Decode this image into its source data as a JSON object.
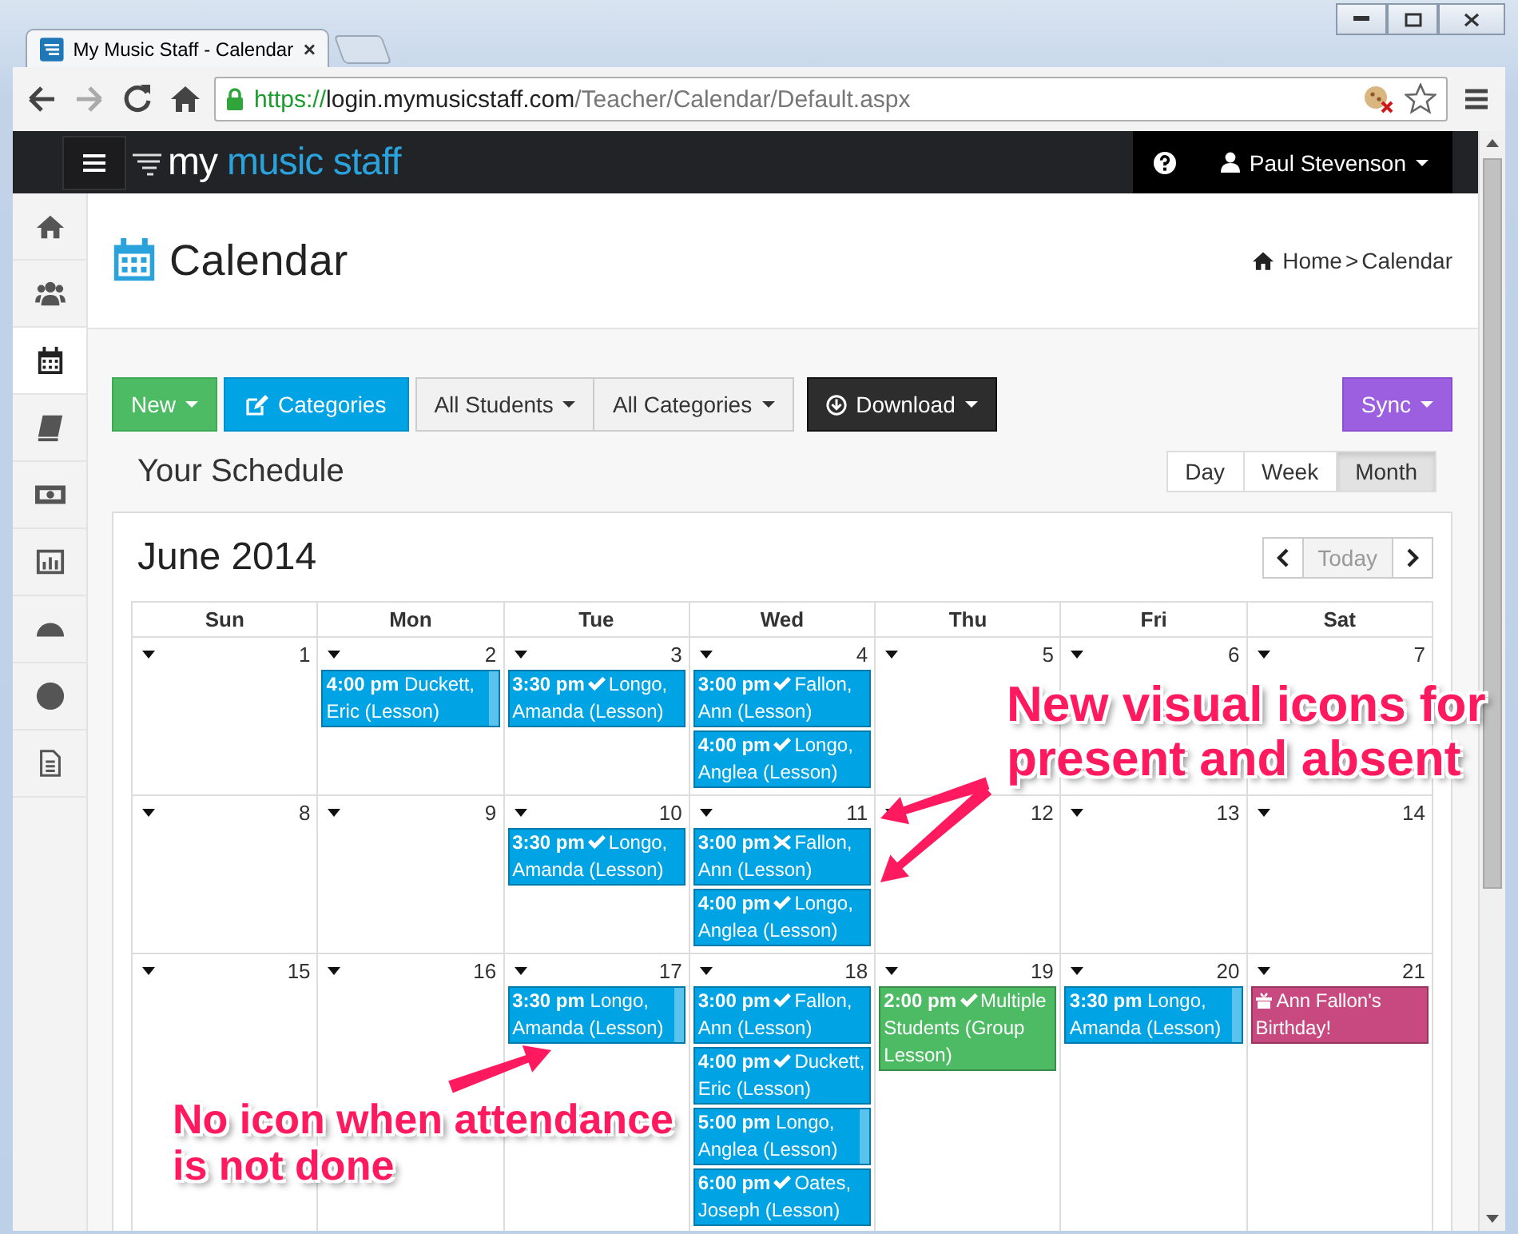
{
  "browser": {
    "tab_title": "My Music Staff - Calendar",
    "url": {
      "scheme": "https://",
      "host": "login.mymusicstaff.com",
      "path": "/Teacher/Calendar/Default.aspx"
    }
  },
  "navbar": {
    "logo": {
      "first": "my",
      "rest": "music staff"
    },
    "user": "Paul Stevenson"
  },
  "sidebar": {
    "items": [
      {
        "selected": false
      },
      {
        "selected": false
      },
      {
        "selected": true
      },
      {
        "selected": false
      },
      {
        "selected": false
      },
      {
        "selected": false
      },
      {
        "selected": false
      },
      {
        "selected": false
      },
      {
        "selected": false
      }
    ]
  },
  "page": {
    "title": "Calendar",
    "breadcrumb": {
      "home": "Home",
      "separator": ">",
      "current": "Calendar"
    }
  },
  "toolbar": {
    "buttons": [
      {
        "label": "New",
        "kind": "new",
        "caret": true
      },
      {
        "label": "Categories",
        "kind": "categories",
        "caret": false
      },
      {
        "label": "All Students",
        "kind": "filter",
        "caret": true
      },
      {
        "label": "All Categories",
        "kind": "filter",
        "caret": true
      },
      {
        "label": "Download",
        "kind": "download",
        "caret": true
      }
    ],
    "sync": {
      "label": "Sync",
      "caret": true
    }
  },
  "schedule": {
    "title": "Your Schedule",
    "views": [
      {
        "label": "Day",
        "selected": false
      },
      {
        "label": "Week",
        "selected": false
      },
      {
        "label": "Month",
        "selected": true
      }
    ]
  },
  "calendar": {
    "title": "June 2014",
    "today": {
      "label": "Today",
      "disabled": true
    },
    "weekdays": [
      "Sun",
      "Mon",
      "Tue",
      "Wed",
      "Thu",
      "Fri",
      "Sat"
    ],
    "weeks": [
      {
        "days": [
          {
            "day": "1"
          },
          {
            "day": "2",
            "events": [
              {
                "kind": "lesson",
                "time": "4:00 pm",
                "marked": false,
                "text": "Duckett, Eric (Lesson)",
                "color": "#00a3e4"
              }
            ]
          },
          {
            "day": "3",
            "events": [
              {
                "kind": "lesson",
                "time": "3:30 pm",
                "marked": true,
                "present": true,
                "text": "Longo, Amanda (Lesson)",
                "color": "#00a3e4"
              }
            ]
          },
          {
            "day": "4",
            "events": [
              {
                "kind": "lesson",
                "time": "3:00 pm",
                "marked": true,
                "present": true,
                "text": "Fallon, Ann (Lesson)",
                "color": "#00a3e4"
              },
              {
                "kind": "lesson",
                "time": "4:00 pm",
                "marked": true,
                "present": true,
                "text": "Longo, Anglea (Lesson)",
                "color": "#00a3e4"
              }
            ]
          },
          {
            "day": "5"
          },
          {
            "day": "6"
          },
          {
            "day": "7"
          }
        ]
      },
      {
        "days": [
          {
            "day": "8"
          },
          {
            "day": "9"
          },
          {
            "day": "10",
            "events": [
              {
                "kind": "lesson",
                "time": "3:30 pm",
                "marked": true,
                "present": true,
                "text": "Longo, Amanda (Lesson)",
                "color": "#00a3e4"
              }
            ]
          },
          {
            "day": "11",
            "events": [
              {
                "kind": "lesson",
                "time": "3:00 pm",
                "marked": true,
                "present": false,
                "text": "Fallon, Ann (Lesson)",
                "color": "#00a3e4"
              },
              {
                "kind": "lesson",
                "time": "4:00 pm",
                "marked": true,
                "present": true,
                "text": "Longo, Anglea (Lesson)",
                "color": "#00a3e4"
              }
            ]
          },
          {
            "day": "12"
          },
          {
            "day": "13"
          },
          {
            "day": "14"
          }
        ]
      },
      {
        "days": [
          {
            "day": "15"
          },
          {
            "day": "16"
          },
          {
            "day": "17",
            "events": [
              {
                "kind": "lesson",
                "time": "3:30 pm",
                "marked": false,
                "text": "Longo, Amanda (Lesson)",
                "color": "#00a3e4"
              }
            ]
          },
          {
            "day": "18",
            "events": [
              {
                "kind": "lesson",
                "time": "3:00 pm",
                "marked": true,
                "present": true,
                "text": "Fallon, Ann (Lesson)",
                "color": "#00a3e4"
              },
              {
                "kind": "lesson",
                "time": "4:00 pm",
                "marked": true,
                "present": true,
                "text": "Duckett, Eric (Lesson)",
                "color": "#00a3e4"
              },
              {
                "kind": "lesson",
                "time": "5:00 pm",
                "marked": false,
                "text": "Longo, Anglea (Lesson)",
                "color": "#00a3e4"
              },
              {
                "kind": "lesson",
                "time": "6:00 pm",
                "marked": true,
                "present": true,
                "text": "Oates, Joseph (Lesson)",
                "color": "#00a3e4"
              }
            ]
          },
          {
            "day": "19",
            "events": [
              {
                "kind": "lesson",
                "time": "2:00 pm",
                "marked": true,
                "present": true,
                "text": "Multiple Students (Group Lesson)",
                "color": "#4cbb63"
              }
            ]
          },
          {
            "day": "20",
            "events": [
              {
                "kind": "lesson",
                "time": "3:30 pm",
                "marked": false,
                "text": "Longo, Amanda (Lesson)",
                "color": "#00a3e4"
              }
            ]
          },
          {
            "day": "21",
            "events": [
              {
                "kind": "birthday",
                "text": "Ann Fallon's Birthday!",
                "color": "#c8497f"
              }
            ]
          }
        ]
      }
    ]
  },
  "annotations": [
    {
      "lines": [
        "New visual icons for",
        "present and absent"
      ]
    },
    {
      "lines": [
        "No icon when attendance",
        "is not done"
      ]
    }
  ]
}
